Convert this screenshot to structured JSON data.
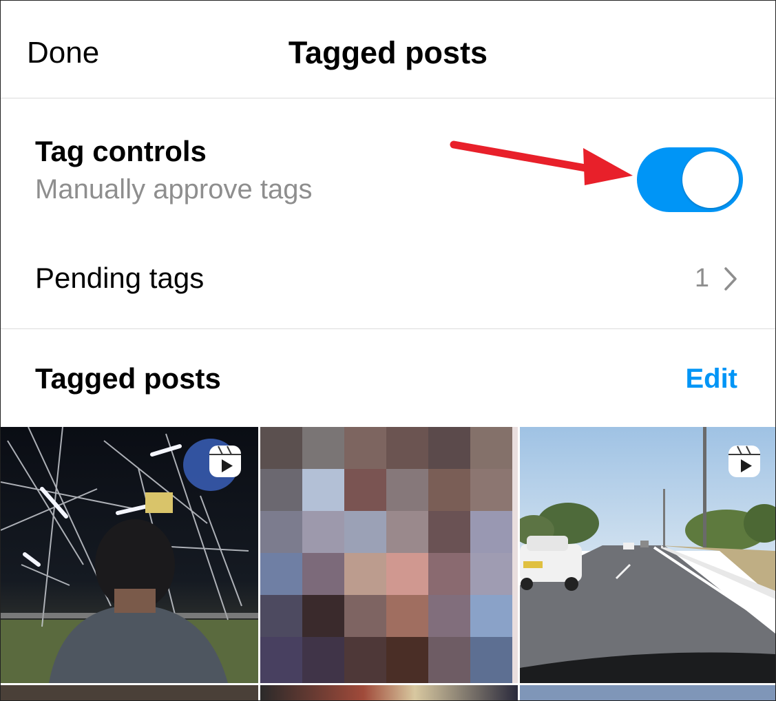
{
  "header": {
    "done_label": "Done",
    "title": "Tagged posts"
  },
  "tag_controls": {
    "title": "Tag controls",
    "subtitle": "Manually approve tags",
    "toggle_on": true
  },
  "pending": {
    "label": "Pending tags",
    "count": "1"
  },
  "tagged_posts": {
    "title": "Tagged posts",
    "edit_label": "Edit"
  },
  "colors": {
    "accent": "#0095f6",
    "annotation_arrow": "#e8202a",
    "secondary_text": "#8e8e8e",
    "divider": "#dbdbdb"
  },
  "icons": {
    "toggle": "toggle-switch",
    "chevron": "chevron-right-icon",
    "reel": "reels-icon",
    "arrow": "annotation-arrow"
  }
}
